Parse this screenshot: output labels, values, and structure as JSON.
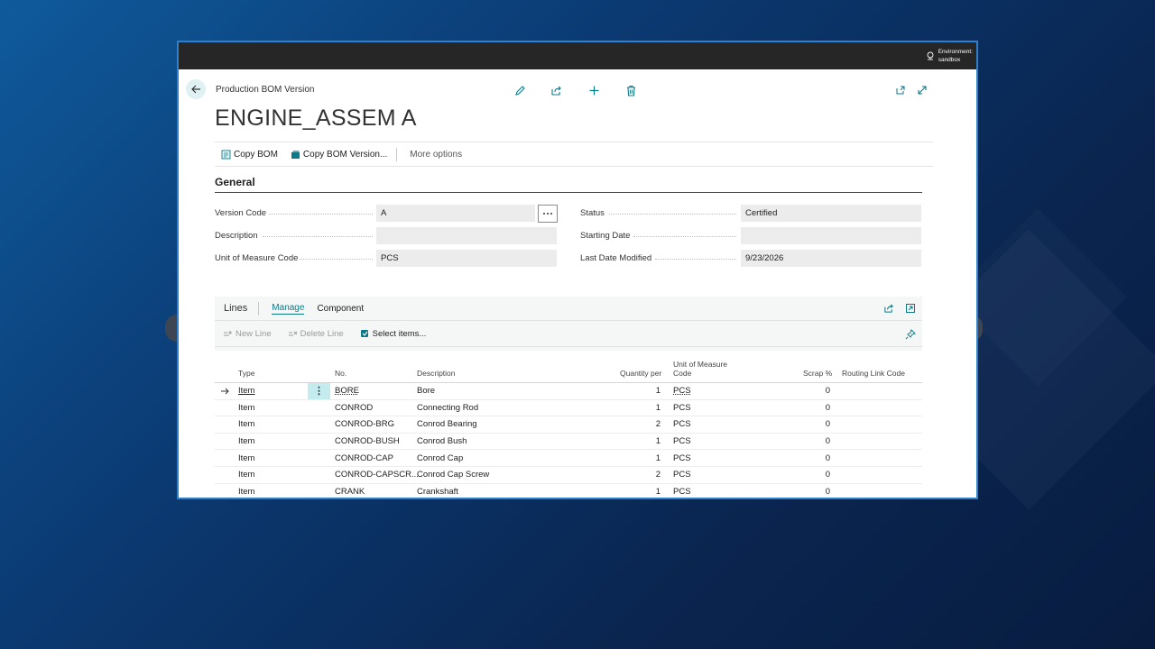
{
  "environment": {
    "line1": "Environment:",
    "line2": "sandbox"
  },
  "page": {
    "breadcrumb": "Production BOM Version",
    "title": "ENGINE_ASSEM A"
  },
  "actions": {
    "copy_bom": "Copy BOM",
    "copy_bom_version": "Copy BOM Version...",
    "more_options": "More options"
  },
  "general": {
    "section_title": "General",
    "version_code": {
      "label": "Version Code",
      "value": "A"
    },
    "description": {
      "label": "Description",
      "value": ""
    },
    "uom_code": {
      "label": "Unit of Measure Code",
      "value": "PCS"
    },
    "status": {
      "label": "Status",
      "value": "Certified"
    },
    "starting_date": {
      "label": "Starting Date",
      "value": ""
    },
    "last_date_modified": {
      "label": "Last Date Modified",
      "value": "9/23/2026"
    }
  },
  "lines": {
    "title": "Lines",
    "tabs": [
      "Manage",
      "Component"
    ],
    "new_line": "New Line",
    "delete_line": "Delete Line",
    "select_items": "Select items...",
    "columns": {
      "type": "Type",
      "no": "No.",
      "description": "Description",
      "qty_per": "Quantity per",
      "uom_line1": "Unit of Measure",
      "uom_line2": "Code",
      "scrap": "Scrap %",
      "routing_link": "Routing Link Code"
    },
    "rows": [
      {
        "type": "Item",
        "no": "BORE",
        "description": "Bore",
        "qty": "1",
        "uom": "PCS",
        "scrap": "0",
        "routing": ""
      },
      {
        "type": "Item",
        "no": "CONROD",
        "description": "Connecting Rod",
        "qty": "1",
        "uom": "PCS",
        "scrap": "0",
        "routing": ""
      },
      {
        "type": "Item",
        "no": "CONROD-BRG",
        "description": "Conrod Bearing",
        "qty": "2",
        "uom": "PCS",
        "scrap": "0",
        "routing": ""
      },
      {
        "type": "Item",
        "no": "CONROD-BUSH",
        "description": "Conrod Bush",
        "qty": "1",
        "uom": "PCS",
        "scrap": "0",
        "routing": ""
      },
      {
        "type": "Item",
        "no": "CONROD-CAP",
        "description": "Conrod Cap",
        "qty": "1",
        "uom": "PCS",
        "scrap": "0",
        "routing": ""
      },
      {
        "type": "Item",
        "no": "CONROD-CAPSCR...",
        "description": "Conrod Cap Screw",
        "qty": "2",
        "uom": "PCS",
        "scrap": "0",
        "routing": ""
      },
      {
        "type": "Item",
        "no": "CRANK",
        "description": "Crankshaft",
        "qty": "1",
        "uom": "PCS",
        "scrap": "0",
        "routing": ""
      }
    ]
  },
  "colors": {
    "accent": "#0b7a88",
    "topbar": "#262626",
    "selected_cell": "#c4ecef"
  }
}
